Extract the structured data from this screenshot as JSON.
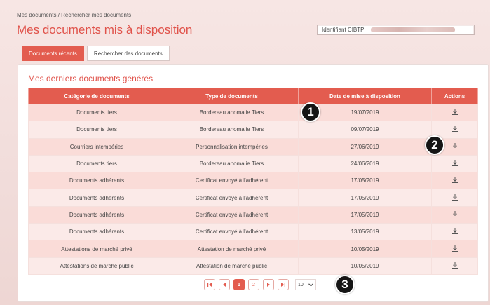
{
  "breadcrumb": "Mes documents / Rechercher mes documents",
  "page_title": "Mes documents mis à disposition",
  "identifier": {
    "label": "Identifiant CIBTP"
  },
  "tabs": [
    {
      "label": "Documents récents",
      "active": true
    },
    {
      "label": "Rechercher des documents",
      "active": false
    }
  ],
  "section_title": "Mes derniers documents générés",
  "table": {
    "columns": [
      "Catégorie de documents",
      "Type de documents",
      "Date de mise à disposition",
      "Actions"
    ],
    "rows": [
      {
        "category": "Documents tiers",
        "type": "Bordereau anomalie Tiers",
        "date": "19/07/2019",
        "action_icon": "download-icon"
      },
      {
        "category": "Documents tiers",
        "type": "Bordereau anomalie Tiers",
        "date": "09/07/2019",
        "action_icon": "download-icon"
      },
      {
        "category": "Courriers intempéries",
        "type": "Personnalisation intempéries",
        "date": "27/06/2019",
        "action_icon": "download-icon"
      },
      {
        "category": "Documents tiers",
        "type": "Bordereau anomalie Tiers",
        "date": "24/06/2019",
        "action_icon": "download-icon"
      },
      {
        "category": "Documents adhérents",
        "type": "Certificat envoyé à l'adhérent",
        "date": "17/05/2019",
        "action_icon": "download-icon"
      },
      {
        "category": "Documents adhérents",
        "type": "Certificat envoyé à l'adhérent",
        "date": "17/05/2019",
        "action_icon": "download-icon"
      },
      {
        "category": "Documents adhérents",
        "type": "Certificat envoyé à l'adhérent",
        "date": "17/05/2019",
        "action_icon": "download-icon"
      },
      {
        "category": "Documents adhérents",
        "type": "Certificat envoyé à l'adhérent",
        "date": "13/05/2019",
        "action_icon": "download-icon"
      },
      {
        "category": "Attestations de marché privé",
        "type": "Attestation de marché privé",
        "date": "10/05/2019",
        "action_icon": "download-icon"
      },
      {
        "category": "Attestations de marché public",
        "type": "Attestation de marché public",
        "date": "10/05/2019",
        "action_icon": "download-icon"
      }
    ]
  },
  "pagination": {
    "first_icon": "first-page-icon",
    "prev_icon": "prev-page-icon",
    "pages": [
      "1",
      "2"
    ],
    "current_page": "1",
    "next_icon": "next-page-icon",
    "last_icon": "last-page-icon",
    "per_page": "10"
  },
  "callouts": [
    "1",
    "2",
    "3"
  ],
  "colors": {
    "accent": "#e35c4f",
    "title": "#e0524a",
    "row_odd": "#fadcd8",
    "row_even": "#fbeae8"
  }
}
